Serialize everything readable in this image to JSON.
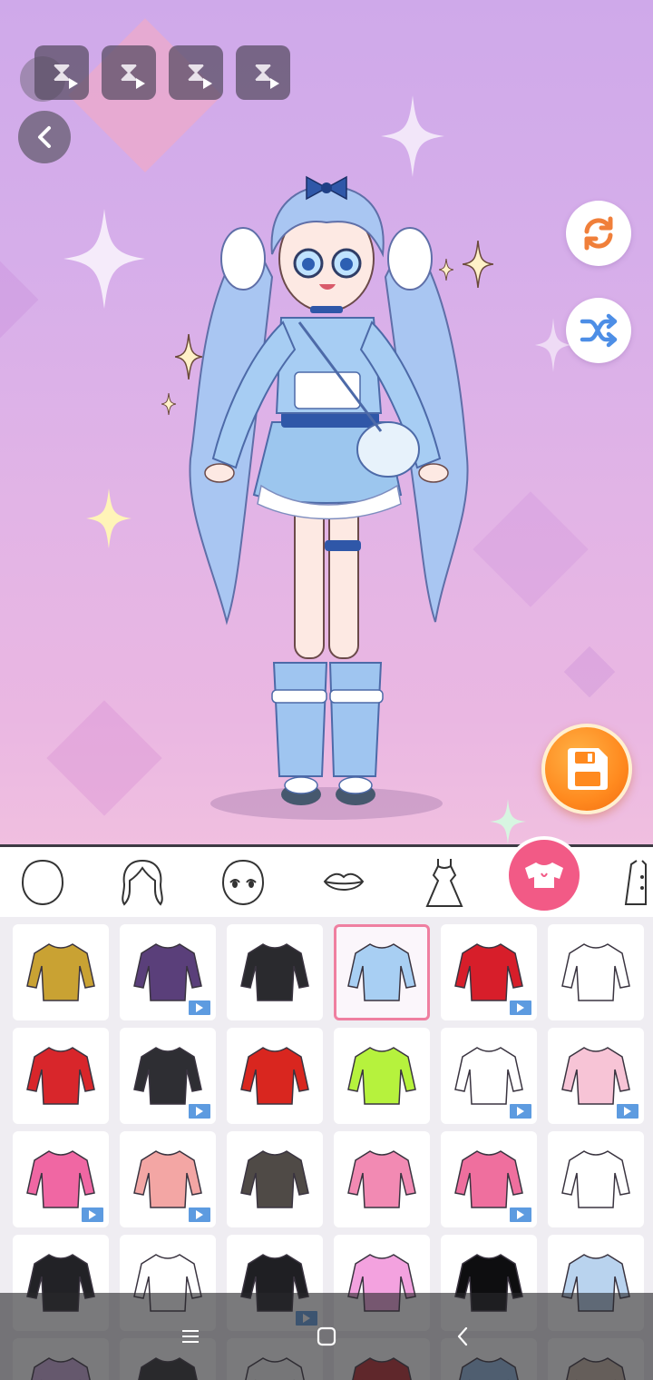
{
  "toolbar": {
    "ad_buttons": [
      "hourglass-video-ad",
      "hourglass-video-ad",
      "hourglass-video-ad",
      "hourglass-video-ad"
    ],
    "icons": {
      "back": "chevron-left-icon",
      "refresh": "refresh-icon",
      "shuffle": "shuffle-icon",
      "save": "floppy-disk-icon"
    },
    "colors": {
      "refresh": "#f07f3a",
      "shuffle": "#4d8ee6",
      "save": "#ff8a1f",
      "accent": "#f25a86"
    }
  },
  "categories": [
    {
      "id": "face",
      "icon": "face-outline-icon"
    },
    {
      "id": "hair",
      "icon": "hair-icon"
    },
    {
      "id": "eyes",
      "icon": "eyes-icon"
    },
    {
      "id": "mouth",
      "icon": "lips-icon"
    },
    {
      "id": "dress",
      "icon": "dress-icon"
    },
    {
      "id": "top",
      "icon": "crop-top-icon",
      "active": true
    },
    {
      "id": "jacket",
      "icon": "jacket-icon"
    }
  ],
  "items": [
    {
      "name": "gold-egyptian-collar",
      "color": "#c9a233",
      "video": false
    },
    {
      "name": "purple-corset-bow",
      "color": "#5a3f7a",
      "video": true
    },
    {
      "name": "black-crop-jacket",
      "color": "#2a2a2e",
      "video": false
    },
    {
      "name": "blue-corset-crop-top",
      "color": "#a8cff3",
      "video": false,
      "selected": true
    },
    {
      "name": "red-ribbon-blouse",
      "color": "#d71e2a",
      "video": true
    },
    {
      "name": "white-collar-shirt",
      "color": "#ffffff",
      "video": false
    },
    {
      "name": "jester-bodysuit",
      "color": "#d8262b",
      "video": false
    },
    {
      "name": "white-shirt-vest",
      "color": "#2e2e33",
      "video": true
    },
    {
      "name": "ladybug-bodysuit",
      "color": "#d9261f",
      "video": false
    },
    {
      "name": "lime-turtleneck",
      "color": "#b6f23d",
      "video": false
    },
    {
      "name": "white-graphic-tee",
      "color": "#ffffff",
      "video": true
    },
    {
      "name": "pink-offshoulder-sweater",
      "color": "#f7c4d6",
      "video": true
    },
    {
      "name": "pink-ruffle-top",
      "color": "#f067a3",
      "video": true
    },
    {
      "name": "pink-kimono-top",
      "color": "#f3a6a4",
      "video": true
    },
    {
      "name": "school-sweater-vest",
      "color": "#4f4a46",
      "video": false
    },
    {
      "name": "pink-raglan-tee",
      "color": "#f28ab3",
      "video": false
    },
    {
      "name": "pink-plaid-shirt",
      "color": "#ef6f9e",
      "video": true
    },
    {
      "name": "white-love-top",
      "color": "#ffffff",
      "video": false
    },
    {
      "name": "black-cutout-top",
      "color": "#222226",
      "video": false
    },
    {
      "name": "white-logo-longsleeve",
      "color": "#ffffff",
      "video": false
    },
    {
      "name": "black-bustier",
      "color": "#1f1f23",
      "video": true
    },
    {
      "name": "pink-tee",
      "color": "#f3a2df",
      "video": false
    },
    {
      "name": "black-turtleneck",
      "color": "#0e0e10",
      "video": false
    },
    {
      "name": "blue-bow-top",
      "color": "#b9d3ee",
      "video": false
    },
    {
      "name": "lilac-bow-top",
      "color": "#c9a7d8",
      "video": false
    },
    {
      "name": "dark-top",
      "color": "#2b2b2e",
      "video": false
    },
    {
      "name": "white-top",
      "color": "#f3f3f3",
      "video": false
    },
    {
      "name": "red-hoodie",
      "color": "#b8262c",
      "video": false
    },
    {
      "name": "blue-top",
      "color": "#8fb6e0",
      "video": false
    },
    {
      "name": "beige-coat",
      "color": "#c8b6a6",
      "video": false
    }
  ],
  "system_nav": {
    "recents": "recents-icon",
    "home": "home-icon",
    "back": "back-icon"
  }
}
